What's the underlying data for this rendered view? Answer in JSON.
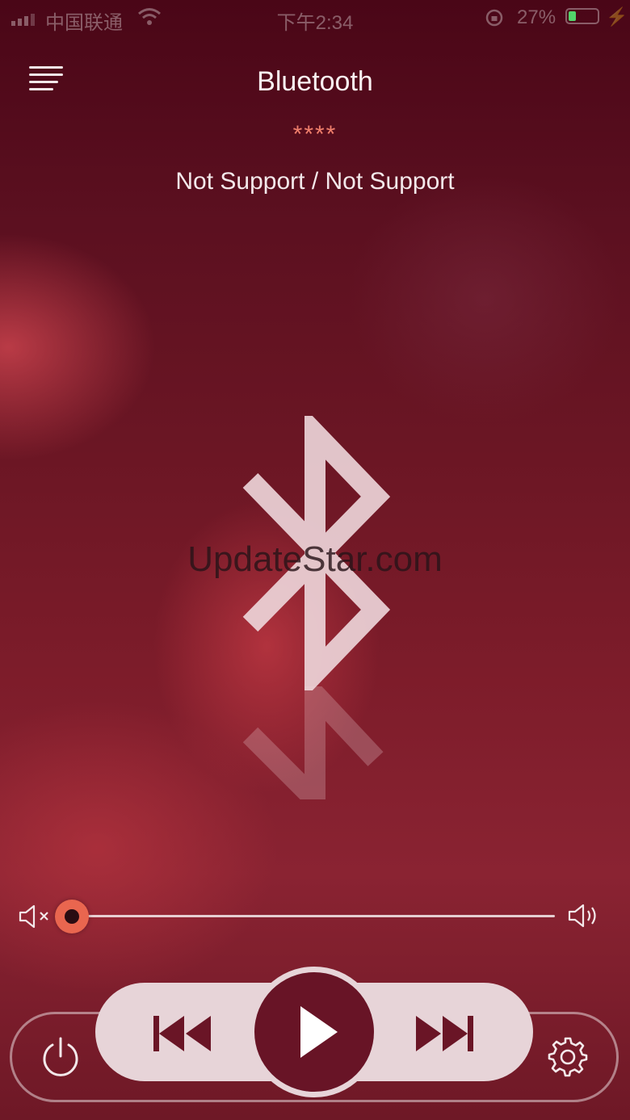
{
  "status_bar": {
    "carrier": "中国联通",
    "time": "下午2:34",
    "battery_percent": "27%",
    "battery_level": 0.27,
    "icons": [
      "signal-icon",
      "wifi-icon",
      "rotation-lock-icon",
      "battery-icon",
      "charging-icon"
    ]
  },
  "header": {
    "title": "Bluetooth",
    "rating": "****",
    "track_info": "Not Support / Not Support"
  },
  "watermark": "UpdateStar.com",
  "volume": {
    "level": 0.0
  },
  "controls": {
    "icons": [
      "menu-icon",
      "bluetooth-icon",
      "mute-icon",
      "volume-up-icon",
      "power-icon",
      "previous-icon",
      "play-icon",
      "next-icon",
      "settings-gear-icon"
    ]
  },
  "colors": {
    "accent": "#e9664f",
    "rating": "#f07f6c",
    "play_button": "#681426",
    "control_bar": "#e7d4d8",
    "battery": "#52d36a"
  }
}
